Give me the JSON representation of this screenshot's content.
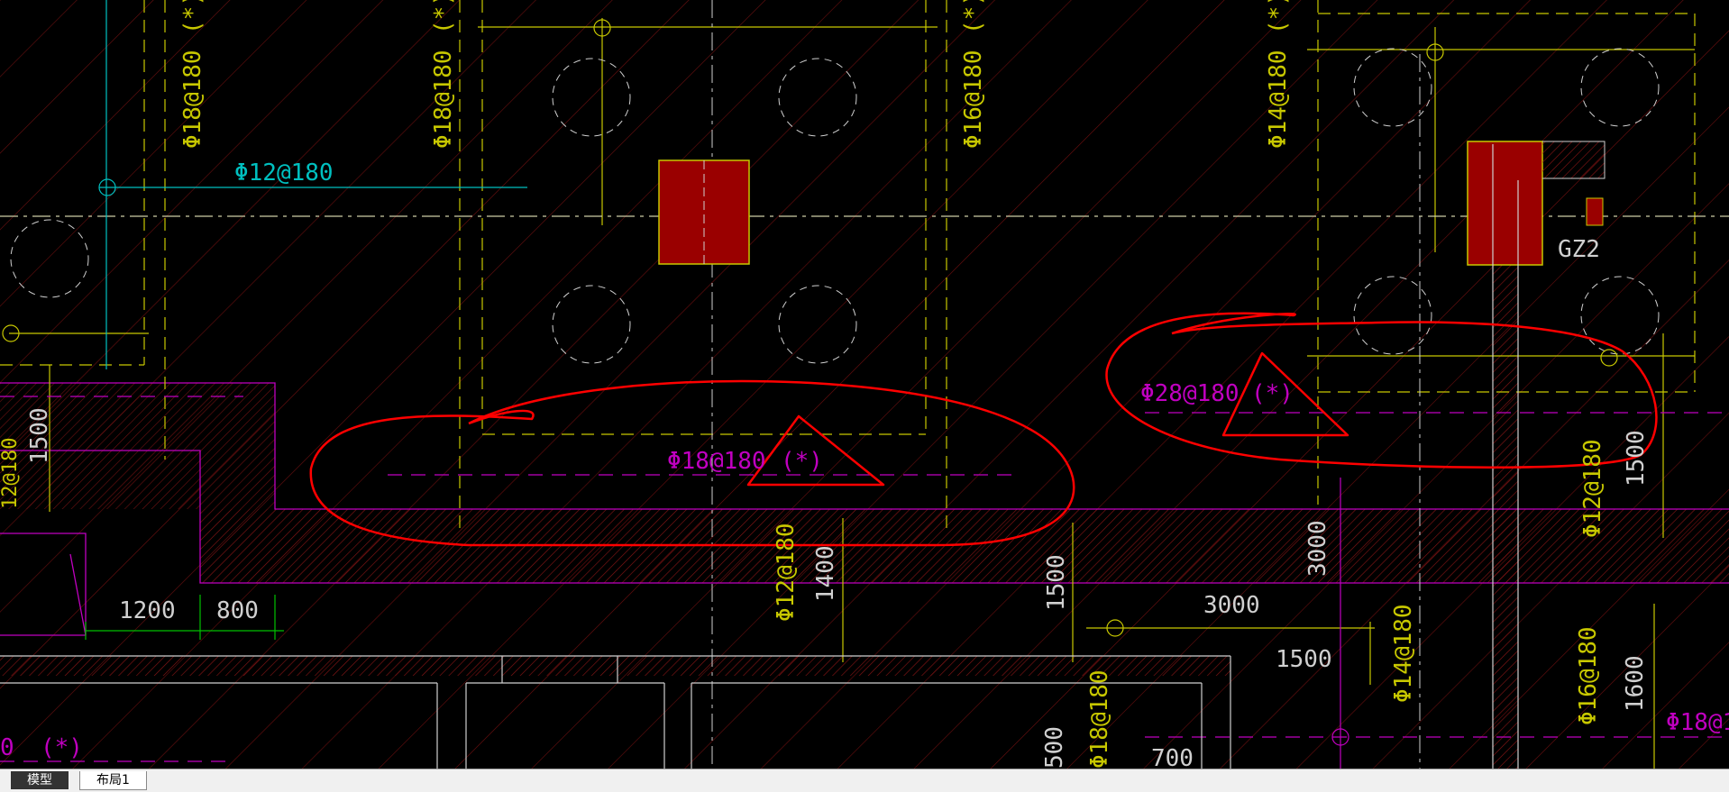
{
  "tabs": [
    {
      "label": "模型",
      "active": true
    },
    {
      "label": "布局1",
      "active": false
    }
  ],
  "colors": {
    "background": "#000000",
    "yellow": "#c8c800",
    "magenta": "#c000c0",
    "cyan": "#00c0c0",
    "green": "#00c000",
    "white": "#d0d0d0",
    "red_markup": "#ff0000",
    "column_fill": "#9a0000",
    "hatch": "#7a1010"
  },
  "labels": {
    "rebar_top_1": "Φ18@180",
    "rebar_top_1_star": "(*)",
    "rebar_top_2": "Φ18@180",
    "rebar_top_2_star": "(*)",
    "rebar_top_3": "Φ16@180",
    "rebar_top_3_star": "(*)",
    "rebar_top_4": "Φ14@180",
    "rebar_top_4_star": "(*)",
    "rebar_cyan": "Φ12@180",
    "rebar_circled_mid": "Φ18@180",
    "rebar_circled_mid_star": "(*)",
    "rebar_circled_right": "Φ28@180",
    "rebar_circled_right_star": "(*)",
    "rebar_vertical_mid": "Φ12@180",
    "rebar_vertical_right": "Φ12@180",
    "rebar_vertical_right2": "Φ14@180",
    "rebar_vertical_far_right": "Φ16@180",
    "rebar_bottom_right": "Φ18@1",
    "rebar_bottom_mid": "Φ18@180",
    "rebar_bottom_left_star": "(*)",
    "rebar_bottom_left_frag": "0",
    "rebar_left_frag": "12@180",
    "column_tag": "GZ2",
    "dim_1500_left": "1500",
    "dim_1200": "1200",
    "dim_800": "800",
    "dim_1400": "1400",
    "dim_1500_mid": "1500",
    "dim_3000_horiz": "3000",
    "dim_3000_vert": "3000",
    "dim_1500_right": "1500",
    "dim_1500_lower": "1500",
    "dim_1600": "1600",
    "dim_700": "700",
    "dim_500": "500"
  }
}
